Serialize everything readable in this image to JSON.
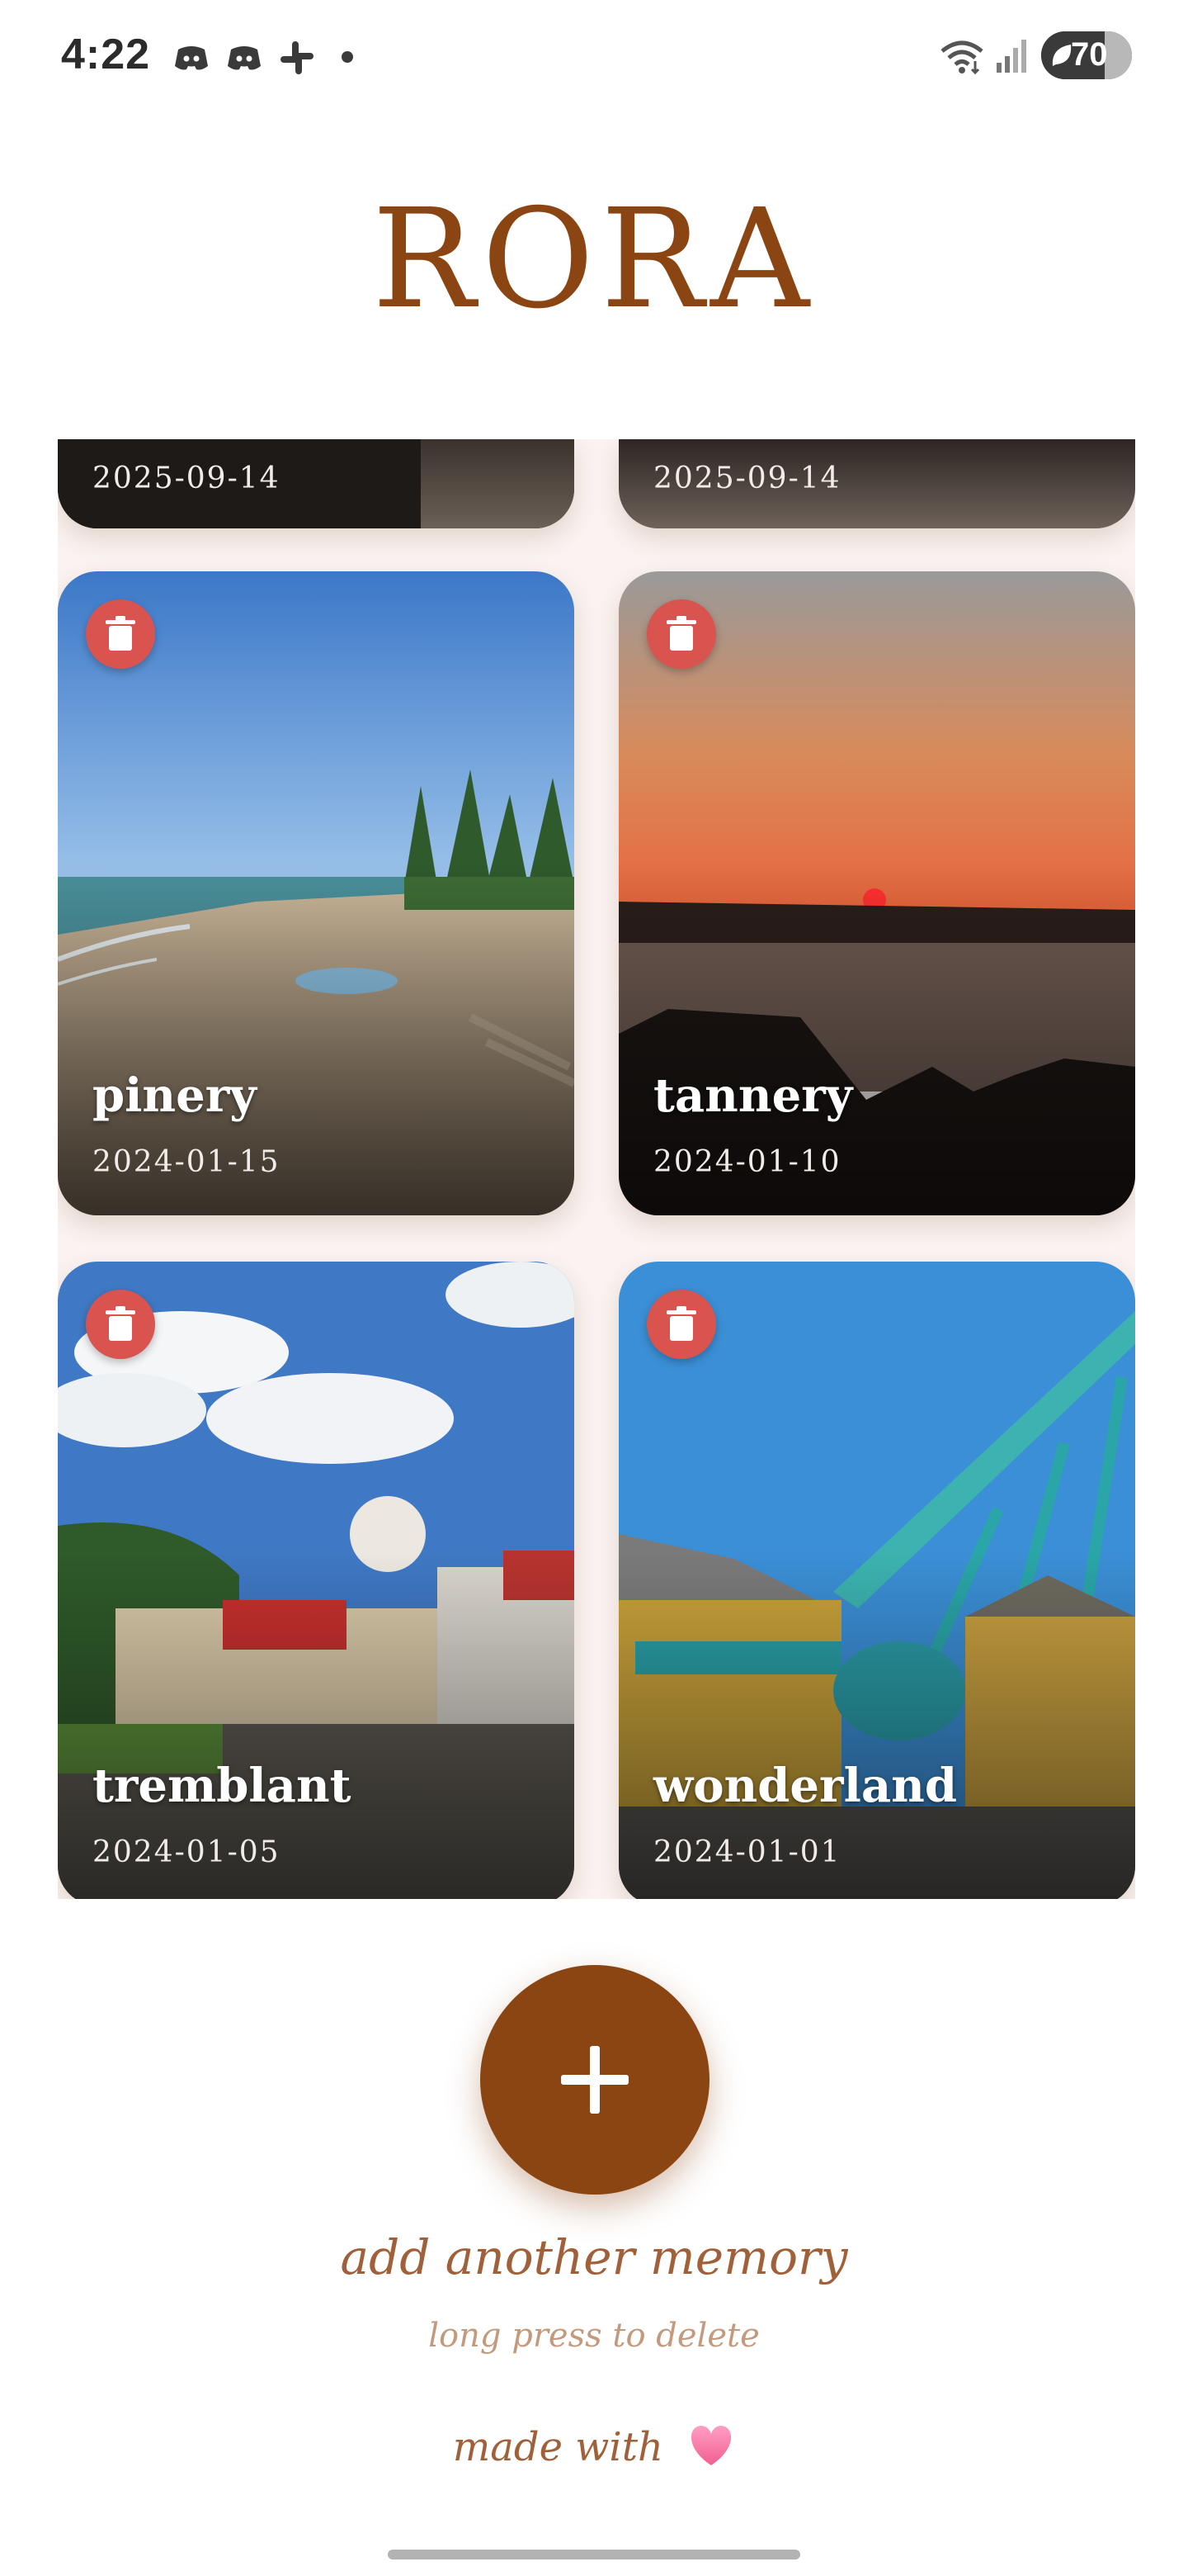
{
  "status_bar": {
    "time": "4:22",
    "battery_level": "70",
    "notification_icons": [
      "discord-icon",
      "discord-icon",
      "slack-icon"
    ]
  },
  "app": {
    "title": "RORA"
  },
  "memories": [
    {
      "name": "",
      "date": "2025-09-14"
    },
    {
      "name": "",
      "date": "2025-09-14"
    },
    {
      "name": "pinery",
      "date": "2024-01-15"
    },
    {
      "name": "tannery",
      "date": "2024-01-10"
    },
    {
      "name": "tremblant",
      "date": "2024-01-05"
    },
    {
      "name": "wonderland",
      "date": "2024-01-01"
    }
  ],
  "actions": {
    "add_label": "add another memory",
    "hint": "long press to delete",
    "delete_icon": "trash-icon"
  },
  "footer": {
    "text": "made with",
    "icon": "heart-icon"
  },
  "colors": {
    "accent": "#8b4513",
    "delete": "#d9534f",
    "background": "#ffffff"
  }
}
